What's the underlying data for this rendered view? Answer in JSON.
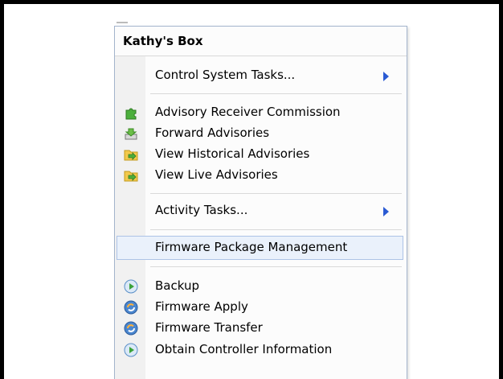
{
  "menu": {
    "title": "Kathy's Box",
    "items": [
      {
        "label": "Control System Tasks...",
        "submenu": true
      },
      {
        "label": "Advisory Receiver Commission",
        "icon": "green-puzzle-icon"
      },
      {
        "label": "Forward Advisories",
        "icon": "inbox-tray-icon"
      },
      {
        "label": "View Historical Advisories",
        "icon": "folder-arrow-icon"
      },
      {
        "label": "View Live Advisories",
        "icon": "folder-arrow-icon"
      },
      {
        "label": "Activity Tasks...",
        "submenu": true
      },
      {
        "label": "Firmware Package Management",
        "highlighted": true
      },
      {
        "label": "Backup",
        "icon": "play-circle-icon"
      },
      {
        "label": "Firmware Apply",
        "icon": "refresh-gear-icon"
      },
      {
        "label": "Firmware Transfer",
        "icon": "refresh-gear-icon"
      },
      {
        "label": "Obtain Controller Information",
        "icon": "play-circle-icon"
      }
    ]
  },
  "colors": {
    "accent": "#2a5ad3",
    "highlight_bg": "#eaf1fb",
    "highlight_border": "#adc3e6",
    "gutter": "#f1f1f1"
  }
}
